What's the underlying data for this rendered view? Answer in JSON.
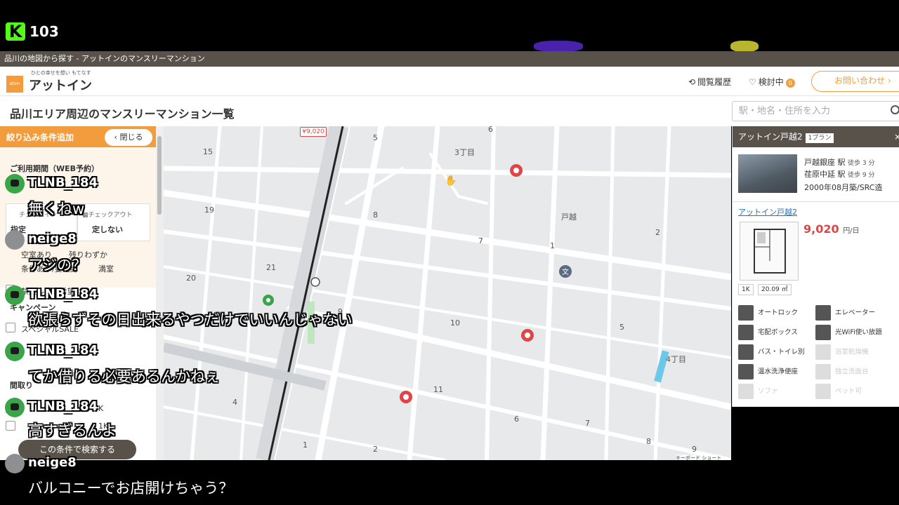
{
  "stream": {
    "viewer_count": "103",
    "logo_letter": "K",
    "accent": "#53fc18"
  },
  "window": {
    "title": "品川の地図から探す - アットインのマンスリーマンション"
  },
  "header": {
    "logo_text": "atinn",
    "tagline": "ひとの幸せを想い もてなす",
    "brand": "アットイン",
    "history_label": "閲覧履歴",
    "favorites_label": "検討中",
    "favorites_count": "0",
    "inquiry_label": "お問い合わせ",
    "accent": "#f39c3d"
  },
  "subheader": {
    "page_title": "品川エリア周辺のマンスリーマンション一覧",
    "search_placeholder": "駅・地名・住所を入力"
  },
  "filter": {
    "title": "絞り込み条件追加",
    "close_label": "閉じる",
    "period_section": "ご利用期間（WEB予約）",
    "checkin_label": "チェックイン",
    "checkout_label": "チェックアウト",
    "checkin_value": "指定",
    "checkout_value": "定しない",
    "availability": [
      "空室あり",
      "残りわずか",
      "条件あり/要確認",
      "満室"
    ],
    "option_smoke": "禁煙ルーム希望",
    "campaign_section": "キャンペーン",
    "option_sale": "スペシャルSALE",
    "layout_section": "間取り",
    "layout_1": "K",
    "layout_2": "1K",
    "search_button": "この条件で検索する"
  },
  "map": {
    "price_pin": "¥9,020",
    "area_labels": [
      "15",
      "5",
      "6",
      "3丁目",
      "19",
      "8",
      "戸越",
      "2",
      "7",
      "1",
      "21",
      "20",
      "9",
      "10",
      "5",
      "4丁目",
      "4",
      "11",
      "6",
      "7",
      "8",
      "1",
      "2",
      "9"
    ],
    "attribution": "キーボード ショート"
  },
  "detail": {
    "title": "アットイン戸越2",
    "plan_badge": "1プラン",
    "close_icon": "×",
    "station1": "戸越銀座 駅",
    "walk1": "徒歩 3 分",
    "station2": "荏原中延 駅",
    "walk2": "徒歩 9 分",
    "built": "2000年08月築/SRC造",
    "link": "アットイン戸越2",
    "price": "9,020",
    "price_unit": "円/日",
    "layout": "1K",
    "area": "20.09 ㎡",
    "amenities": [
      {
        "label": "オートロック",
        "active": true
      },
      {
        "label": "エレベーター",
        "active": true
      },
      {
        "label": "宅配ボックス",
        "active": true
      },
      {
        "label": "光WiFi使い放題",
        "active": true
      },
      {
        "label": "バス・トイレ別",
        "active": true
      },
      {
        "label": "浴室乾燥機",
        "active": false
      },
      {
        "label": "温水洗浄便座",
        "active": true
      },
      {
        "label": "独立洗面台",
        "active": false
      },
      {
        "label": "ソファ",
        "active": false
      },
      {
        "label": "ペット可",
        "active": false
      }
    ]
  },
  "chat": [
    {
      "user": "TLNB_184",
      "message": "無くねw"
    },
    {
      "user": "neige8",
      "message": "アジの？"
    },
    {
      "user": "TLNB_184",
      "message": "欲張らずその日出来るやつだけでいいんじゃない"
    },
    {
      "user": "TLNB_184",
      "message": "てか借りる必要あるんかねぇ"
    },
    {
      "user": "TLNB_184",
      "message": "高すぎるんよ"
    },
    {
      "user": "neige8",
      "message": "バルコニーでお店開けちゃう？"
    }
  ]
}
